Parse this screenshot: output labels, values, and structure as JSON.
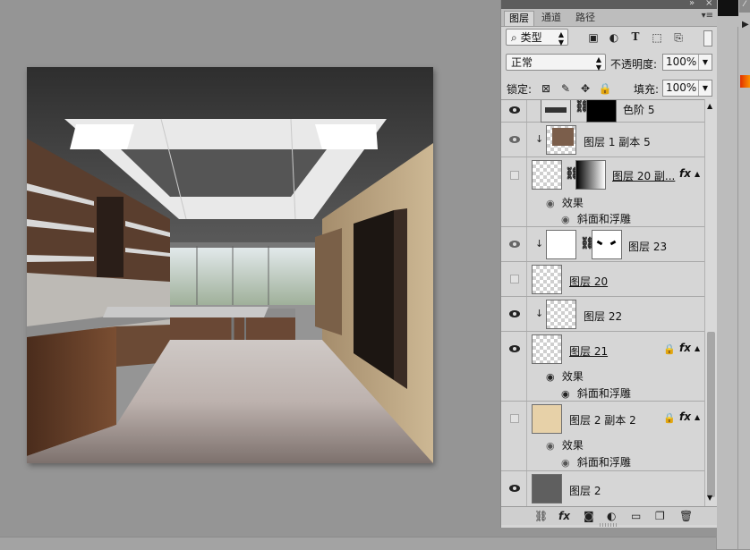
{
  "panel": {
    "tabs": [
      {
        "label": "图层",
        "active": true
      },
      {
        "label": "通道",
        "active": false
      },
      {
        "label": "路径",
        "active": false
      }
    ],
    "filter": {
      "label": "类型"
    },
    "blend_mode": "正常",
    "opacity_label": "不透明度:",
    "opacity_value": "100%",
    "lock_label": "锁定:",
    "fill_label": "填充:",
    "fill_value": "100%"
  },
  "layers": [
    {
      "name": "色阶 5",
      "visible": true,
      "type": "adjustment"
    },
    {
      "name": "图层 1 副本 5",
      "visible": true,
      "clipped": true
    },
    {
      "name": "图层 20 副...",
      "visible": false,
      "has_mask": true,
      "fx": true,
      "effects_label": "效果",
      "effect": "斜面和浮雕"
    },
    {
      "name": "图层 23",
      "visible": true,
      "clipped": true,
      "has_mask": true
    },
    {
      "name": "图层 20",
      "visible": false
    },
    {
      "name": "图层 22",
      "visible": true,
      "clipped": true
    },
    {
      "name": "图层 21",
      "visible": true,
      "locked": true,
      "fx": true,
      "effects_label": "效果",
      "effect": "斜面和浮雕"
    },
    {
      "name": "图层 2 副本 2",
      "visible": false,
      "locked": true,
      "fx": true,
      "effects_label": "效果",
      "effect": "斜面和浮雕"
    },
    {
      "name": "图层 2",
      "visible": true
    }
  ],
  "icons": {
    "eye": "eye-icon",
    "chain": "link-icon",
    "lock": "lock-icon",
    "fx": "fx-icon",
    "new_layer": "new-layer-icon",
    "delete": "trash-icon",
    "folder": "folder-icon",
    "mask": "mask-icon",
    "adjustment": "adjustment-icon"
  },
  "labels": {
    "fx": "fx"
  },
  "colors": {
    "panel_bg": "#d6d6d6",
    "workspace_bg": "#959595",
    "ruler_accent": "#e03000"
  }
}
